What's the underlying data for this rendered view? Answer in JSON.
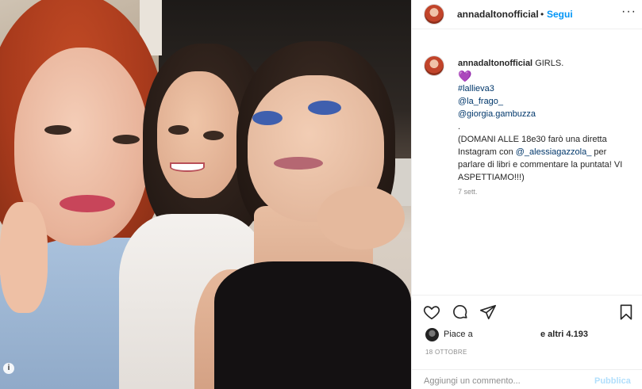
{
  "header": {
    "username": "annadaltonofficial",
    "dot": "•",
    "follow_label": "Segui",
    "more_label": "···"
  },
  "caption": {
    "username": "annadaltonofficial",
    "title": "GIRLS.",
    "heart": "💜",
    "hashtag": "#lallieva3",
    "mention1": "@la_frago_",
    "mention2": "@giorgia.gambuzza",
    "dot_line": ".",
    "text_part1": "(DOMANI ALLE 18e30 farò una diretta Instagram con ",
    "mention3": "@_alessiagazzola_",
    "text_part2": " per parlare di libri e commentare la puntata! VI ASPETTIAMO!!!)",
    "time": "7 sett."
  },
  "actions": {
    "like_icon": "heart-icon",
    "comment_icon": "comment-icon",
    "share_icon": "share-icon",
    "save_icon": "bookmark-icon"
  },
  "likes": {
    "liked_by": "Piace a",
    "others": "e altri 4.193"
  },
  "date": "18 OTTOBRE",
  "comment": {
    "placeholder": "Aggiungi un commento...",
    "publish_label": "Pubblica"
  },
  "photo": {
    "info_badge": "i"
  }
}
